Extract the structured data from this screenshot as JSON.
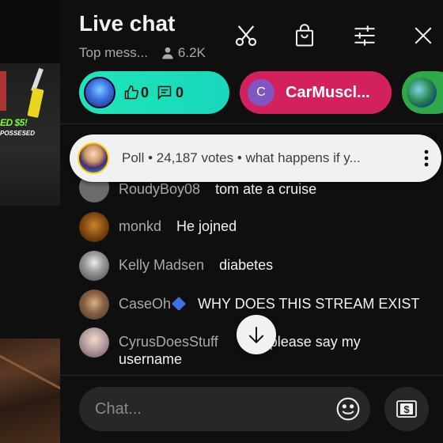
{
  "header": {
    "title": "Live chat",
    "mode": "Top mess...",
    "viewers": "6.2K"
  },
  "pinned": {
    "first": {
      "likes": "0",
      "comments": "0"
    },
    "second": {
      "letter": "C",
      "name": "CarMuscl..."
    }
  },
  "video": {
    "promo_line1": "ED $5!",
    "promo_line2": "POSSESED"
  },
  "poll": {
    "text": "Poll • 24,187 votes • what happens if y..."
  },
  "messages": [
    {
      "author": "RoudyBoy08",
      "text": "tom ate a cruise"
    },
    {
      "author": "monkd",
      "text": "He jojned"
    },
    {
      "author": "Kelly Madsen",
      "text": "diabetes"
    },
    {
      "author": "CaseOh",
      "text": "WHY DOES THIS STREAM EXIST"
    },
    {
      "author": "CyrusDoesStuff",
      "text": "please say my username"
    }
  ],
  "input": {
    "placeholder": "Chat..."
  },
  "colors": {
    "background": "#0f0f0f",
    "chip_green": "#1ee6b8",
    "chip_red": "#d3215e",
    "poll_bg": "#f1f1f1",
    "author": "#aaaaaa",
    "verified": "#3e6ee8"
  },
  "icons": [
    "scissors-icon",
    "shopping-bag-icon",
    "filter-sliders-icon",
    "close-icon",
    "person-icon",
    "thumbs-up-icon",
    "comment-icon",
    "more-vert-icon",
    "arrow-down-icon",
    "emoji-icon",
    "super-chat-icon"
  ]
}
